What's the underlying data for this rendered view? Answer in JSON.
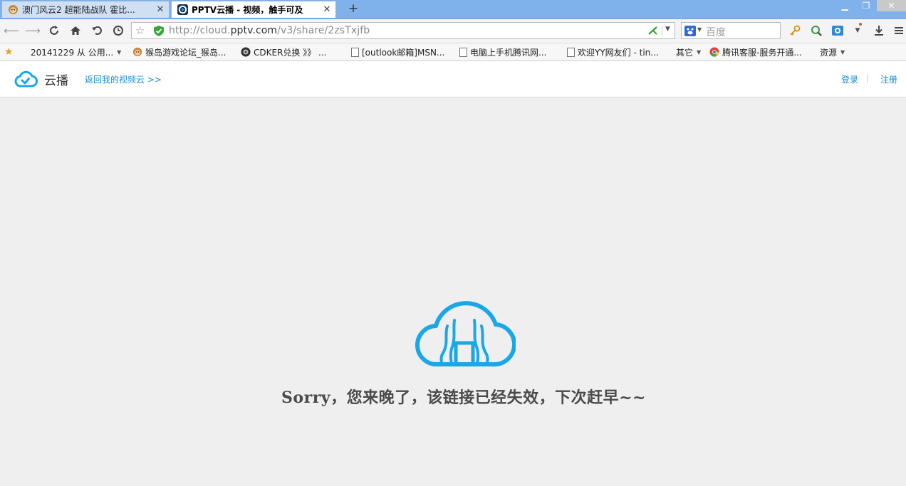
{
  "browser": {
    "tabs": [
      {
        "label": "澳门风云2 超能陆战队 霍比...",
        "active": false
      },
      {
        "label": "PPTV云播 - 视频，触手可及",
        "active": true
      }
    ],
    "new_tab_label": "+",
    "address": {
      "prefix": "http://cloud.",
      "host": "pptv.com",
      "path": "/v3/share/2zsTxjfb"
    },
    "search_placeholder": "百度",
    "bookmarks": [
      {
        "label": "20141229 从 公用...",
        "icon": "folder-icon",
        "dropdown": true
      },
      {
        "label": "猴岛游戏论坛_猴岛...",
        "icon": "monkey-icon"
      },
      {
        "label": "CDKER兑换 》》 ...",
        "icon": "cdker-icon"
      },
      {
        "label": "[outlook邮箱]MSN...",
        "icon": "page-icon"
      },
      {
        "label": "电脑上手机腾讯网...",
        "icon": "page-icon"
      },
      {
        "label": "欢迎YY网友们 - tin...",
        "icon": "page-icon"
      },
      {
        "label": "其它",
        "icon": "",
        "dropdown": true
      },
      {
        "label": "腾讯客服-服务开通...",
        "icon": "chrome-icon"
      },
      {
        "label": "资源",
        "icon": "",
        "dropdown": true
      }
    ]
  },
  "site": {
    "brand": "云播",
    "back_link": "返回我的视频云 >>",
    "login": "登录",
    "register": "注册",
    "accent": "#1aa7e8"
  },
  "message": "Sorry，您来晚了，该链接已经失效，下次赶早~~"
}
